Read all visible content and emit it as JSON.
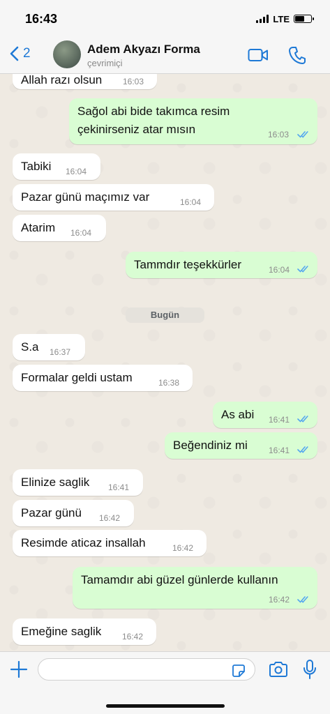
{
  "status_bar": {
    "time": "16:43",
    "network": "LTE"
  },
  "header": {
    "back_count": "2",
    "title": "Adem Akyazı Forma",
    "subtitle": "çevrimiçi"
  },
  "messages": [
    {
      "dir": "in",
      "text": "Allah razı olsun",
      "time": "16:03"
    },
    {
      "dir": "out",
      "text": "Sağol abi bide takımca resim\nçekinirseniz atar mısın",
      "time": "16:03",
      "read": true
    },
    {
      "dir": "in",
      "text": "Tabiki",
      "time": "16:04"
    },
    {
      "dir": "in",
      "text": "Pazar günü maçımız var",
      "time": "16:04"
    },
    {
      "dir": "in",
      "text": "Atarim",
      "time": "16:04"
    },
    {
      "dir": "out",
      "text": "Tammdır teşekkürler",
      "time": "16:04",
      "read": true
    },
    {
      "dir": "in",
      "text": "S.a",
      "time": "16:37"
    },
    {
      "dir": "in",
      "text": "Formalar geldi ustam",
      "time": "16:38"
    },
    {
      "dir": "out",
      "text": "As abi",
      "time": "16:41",
      "read": true
    },
    {
      "dir": "out",
      "text": "Beğendiniz mi",
      "time": "16:41",
      "read": true
    },
    {
      "dir": "in",
      "text": "Elinize saglik",
      "time": "16:41"
    },
    {
      "dir": "in",
      "text": "Pazar günü",
      "time": "16:42"
    },
    {
      "dir": "in",
      "text": "Resimde aticaz insallah",
      "time": "16:42"
    },
    {
      "dir": "out",
      "text": "Tamamdır abi güzel günlerde kullanın",
      "time": "16:42",
      "read": true
    },
    {
      "dir": "in",
      "text": "Emeğine saglik",
      "time": "16:42"
    }
  ],
  "date_separator": "Bugün",
  "colors": {
    "accent": "#1e79d6",
    "outgoing_bubble": "#d9fdd3",
    "incoming_bubble": "#ffffff",
    "chat_bg": "#efeae2"
  },
  "icons": {
    "back": "chevron-left-icon",
    "video": "video-camera-icon",
    "call": "phone-icon",
    "attach": "plus-icon",
    "sticker": "sticker-icon",
    "camera": "camera-icon",
    "mic": "microphone-icon",
    "read_receipt": "double-check-icon"
  }
}
